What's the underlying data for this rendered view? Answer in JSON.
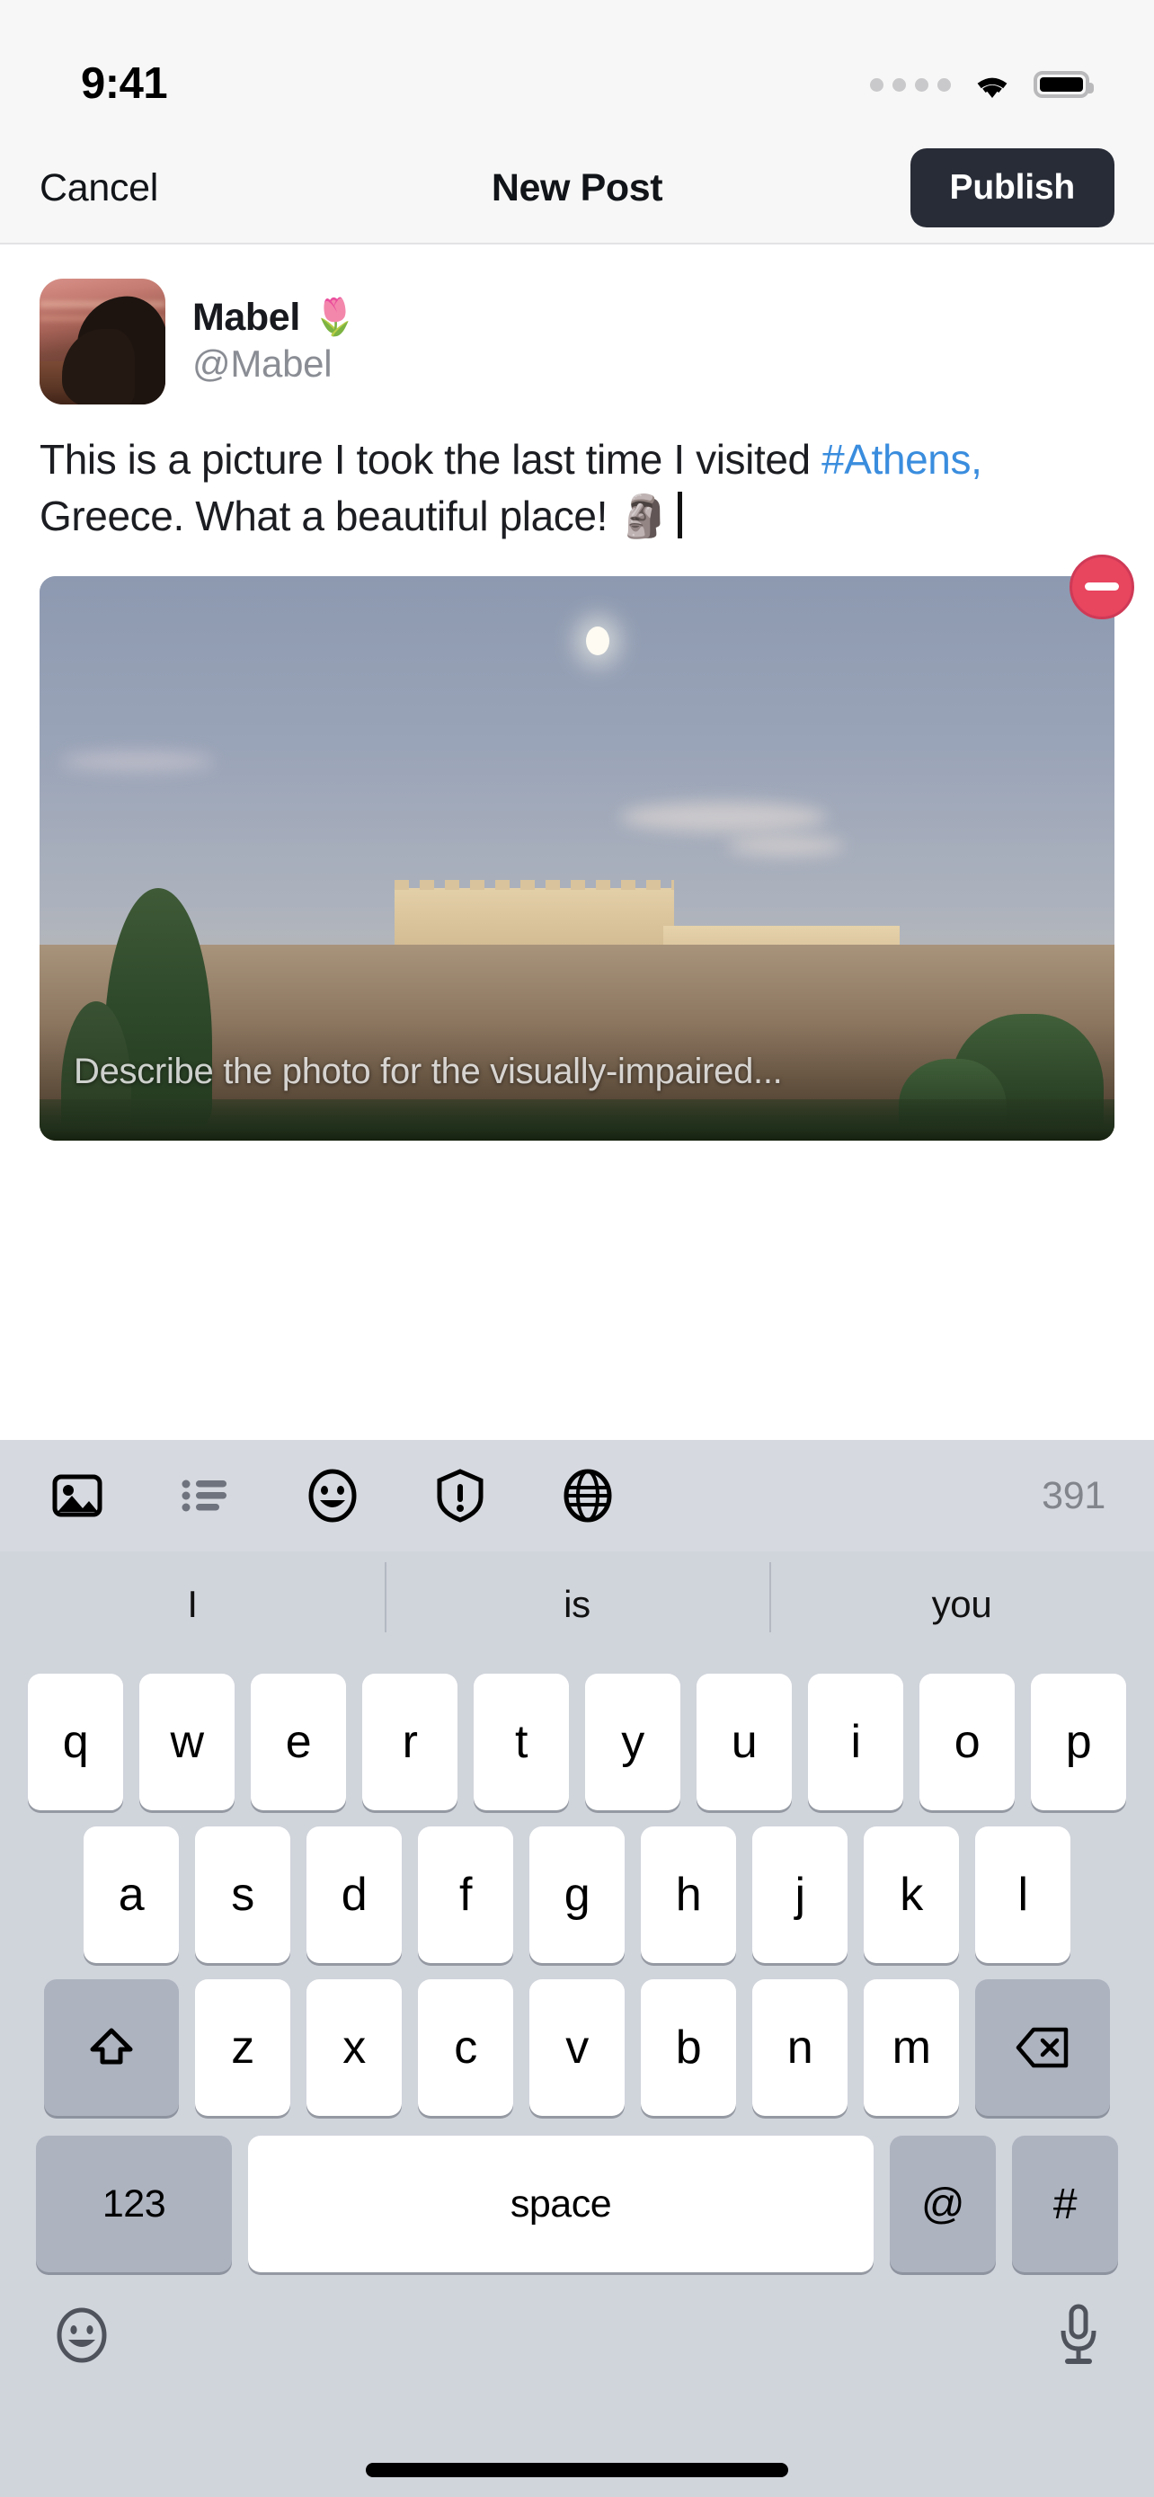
{
  "status_bar": {
    "time": "9:41",
    "signal_icon": "signal-dots-icon",
    "wifi_icon": "wifi-icon",
    "battery_icon": "battery-full-icon"
  },
  "nav_bar": {
    "cancel_label": "Cancel",
    "title": "New Post",
    "publish_label": "Publish",
    "publish_bg": "#282c37"
  },
  "composer": {
    "author": {
      "display_name": "Mabel",
      "name_emoji": "🌷",
      "handle": "@Mabel",
      "avatar_icon": "avatar"
    },
    "post_text": {
      "line1": "This is a picture I took the last time I visited",
      "hashtag": "#Athens,",
      "line2_rest": "Greece. What a beautiful place!",
      "trailing_emoji": "🗿",
      "hashtag_color": "#3a8dde"
    },
    "media": {
      "alt_placeholder": "Describe the photo for the visually-impaired...",
      "remove_button_label": "remove-media",
      "remove_button_color": "#e8455f"
    }
  },
  "action_bar": {
    "icons": [
      {
        "name": "add-image-icon",
        "label": "Add image"
      },
      {
        "name": "poll-list-icon",
        "label": "Add poll"
      },
      {
        "name": "emoji-icon",
        "label": "Insert emoji"
      },
      {
        "name": "content-warning-shield-icon",
        "label": "Content warning"
      },
      {
        "name": "visibility-globe-icon",
        "label": "Post visibility"
      }
    ],
    "char_count": "391"
  },
  "keyboard": {
    "predictions": [
      "I",
      "is",
      "you"
    ],
    "row1": [
      "q",
      "w",
      "e",
      "r",
      "t",
      "y",
      "u",
      "i",
      "o",
      "p"
    ],
    "row2": [
      "a",
      "s",
      "d",
      "f",
      "g",
      "h",
      "j",
      "k",
      "l"
    ],
    "row3": [
      "z",
      "x",
      "c",
      "v",
      "b",
      "n",
      "m"
    ],
    "shift_label": "shift-key-icon",
    "backspace_label": "backspace-key-icon",
    "numbers_label": "123",
    "space_label": "space",
    "at_label": "@",
    "hash_label": "#",
    "emoji_button": "emoji-keyboard-icon",
    "dictation_button": "microphone-icon"
  }
}
